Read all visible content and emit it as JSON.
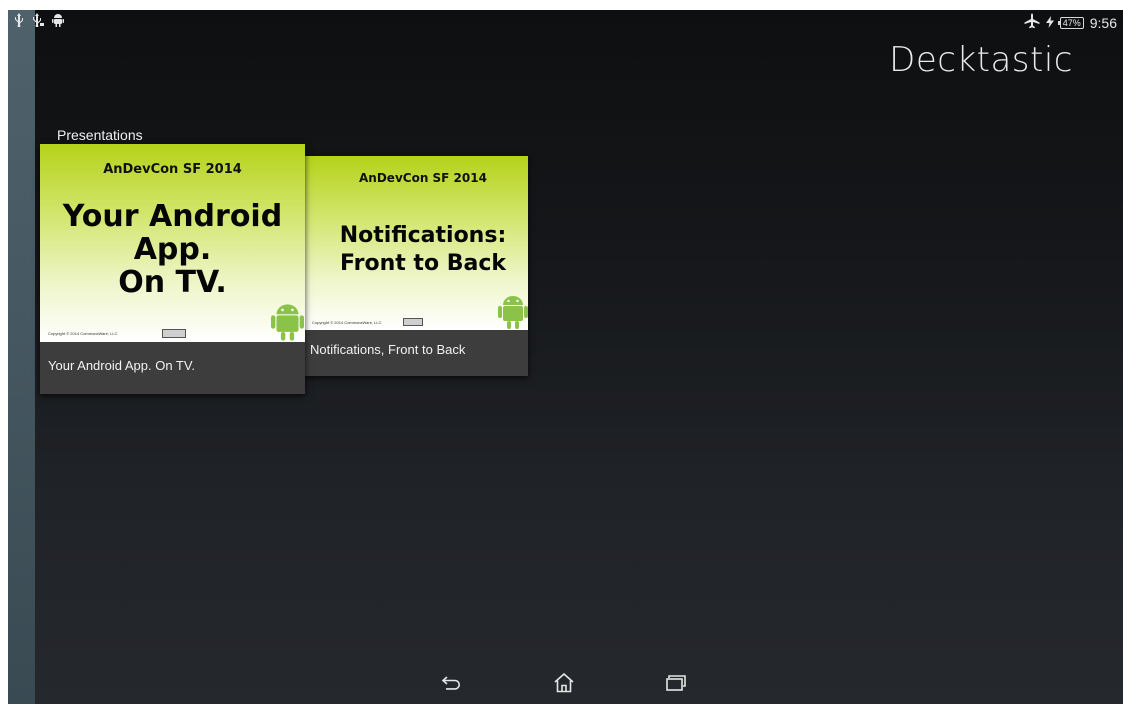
{
  "status_bar": {
    "left_icons": [
      "usb-icon",
      "usb-debug-icon",
      "android-icon"
    ],
    "right_icons": [
      "airplane-mode-icon",
      "charging-icon"
    ],
    "battery": "47%",
    "time": "9:56"
  },
  "app": {
    "title": "Decktastic"
  },
  "section": {
    "header": "Presentations"
  },
  "presentations": [
    {
      "slide": {
        "conference": "AnDevCon SF 2014",
        "heading_lines": [
          "Your Android",
          "App.",
          "On TV."
        ],
        "copyright": "Copyright © 2014 CommonsWare, LLC"
      },
      "caption": "Your Android App. On TV."
    },
    {
      "slide": {
        "conference": "AnDevCon SF 2014",
        "heading_lines": [
          "Notifications:",
          "Front to Back"
        ],
        "copyright": "Copyright © 2014 CommonsWare, LLC"
      },
      "caption": "Notifications, Front to Back"
    }
  ],
  "nav_bar": {
    "icons": [
      "back-icon",
      "home-icon",
      "recent-apps-icon"
    ]
  },
  "colors": {
    "slide_green": "#b5d21a",
    "android_green": "#8bc34a",
    "caption_bg": "#3d3d3d",
    "rail": "#4f626c"
  }
}
